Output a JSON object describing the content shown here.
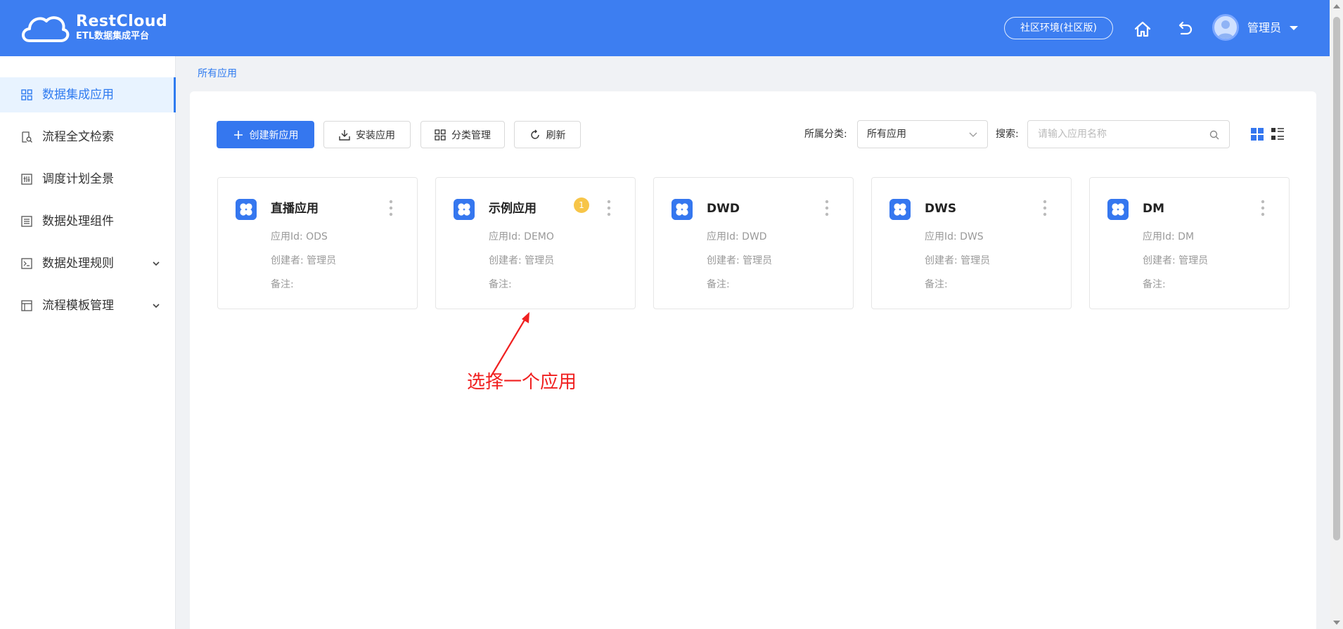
{
  "header": {
    "brand_name": "RestCloud",
    "brand_sub": "ETL数据集成平台",
    "env_label": "社区环境(社区版)",
    "user_name": "管理员",
    "color": "#3d7ef1"
  },
  "sidebar": {
    "items": [
      {
        "label": "数据集成应用",
        "icon": "grid-icon",
        "active": true
      },
      {
        "label": "流程全文检索",
        "icon": "doc-search-icon"
      },
      {
        "label": "调度计划全景",
        "icon": "schedule-icon"
      },
      {
        "label": "数据处理组件",
        "icon": "list-icon"
      },
      {
        "label": "数据处理规则",
        "icon": "terminal-icon",
        "expandable": true
      },
      {
        "label": "流程模板管理",
        "icon": "template-icon",
        "expandable": true
      }
    ]
  },
  "breadcrumb": "所有应用",
  "toolbar": {
    "create_label": "创建新应用",
    "install_label": "安装应用",
    "category_label": "分类管理",
    "refresh_label": "刷新",
    "filter_label": "所属分类:",
    "filter_value": "所有应用",
    "search_label": "搜索:",
    "search_placeholder": "请输入应用名称"
  },
  "cards": [
    {
      "title": "直播应用",
      "app_id": "应用Id: ODS",
      "creator": "创建者: 管理员",
      "note": "备注:"
    },
    {
      "title": "示例应用",
      "app_id": "应用Id: DEMO",
      "creator": "创建者: 管理员",
      "note": "备注:",
      "badge": "1"
    },
    {
      "title": "DWD",
      "app_id": "应用Id: DWD",
      "creator": "创建者: 管理员",
      "note": "备注:"
    },
    {
      "title": "DWS",
      "app_id": "应用Id: DWS",
      "creator": "创建者: 管理员",
      "note": "备注:"
    },
    {
      "title": "DM",
      "app_id": "应用Id: DM",
      "creator": "创建者: 管理员",
      "note": "备注:"
    }
  ],
  "annotation": "选择一个应用",
  "colors": {
    "primary": "#3577ef",
    "active_bg": "#e8f3ff",
    "annotation": "#f02020",
    "badge": "#f7c548"
  }
}
